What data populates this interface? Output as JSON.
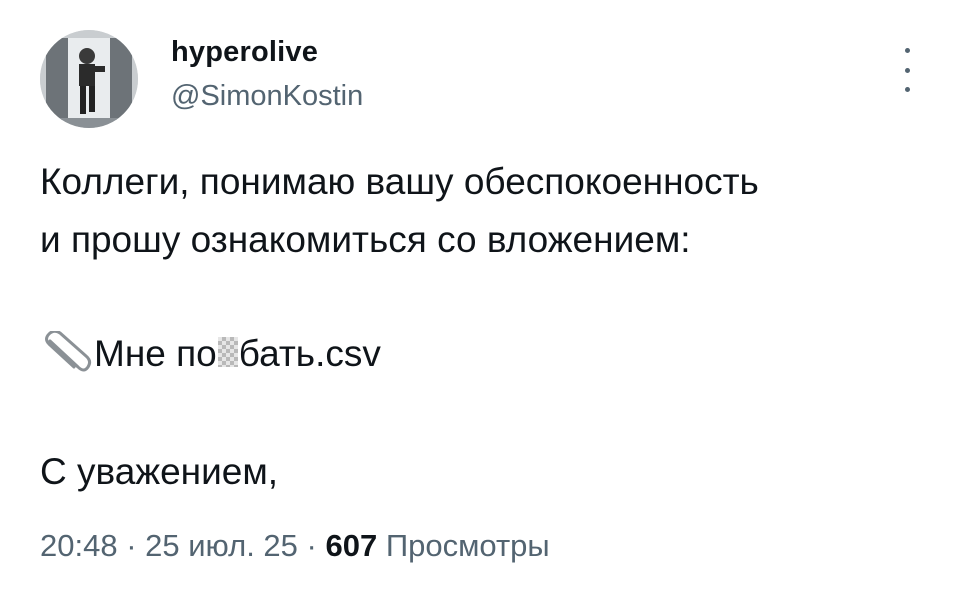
{
  "author": {
    "display_name": "hyperolive",
    "handle": "@SimonKostin",
    "avatar_icon": "avatar-photo"
  },
  "tweet": {
    "line1": "Коллеги, понимаю вашу обеспокоенность",
    "line2": "и прошу ознакомиться со вложением:",
    "attachment_prefix": "Мне по",
    "attachment_suffix": "бать.csv",
    "attachment_icon": "paperclip-icon",
    "signoff": "С уважением,"
  },
  "meta": {
    "time": "20:48",
    "sep1": " · ",
    "date": "25 июл. 25",
    "sep2": " · ",
    "views_count": "607",
    "views_label": " Просмотры"
  },
  "colors": {
    "text": "#0f1419",
    "secondary": "#536471",
    "background": "#ffffff"
  }
}
